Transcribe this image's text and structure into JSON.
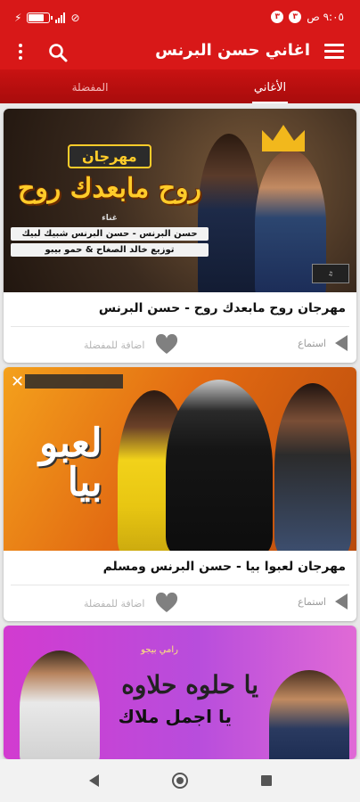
{
  "status_bar": {
    "time": "٩:٠٥ ص",
    "notification_icons": [
      "٣",
      "٣"
    ],
    "battery_level": 0.76,
    "battery_label": "76"
  },
  "app_bar": {
    "title": "اغاني حسن البرنس",
    "icons": [
      "menu-icon",
      "search-icon",
      "more-vert-icon"
    ]
  },
  "tabs": [
    {
      "label": "الأغاني",
      "active": true
    },
    {
      "label": "المفضلة",
      "active": false
    }
  ],
  "cards": [
    {
      "title": "مهرجان روح مابعدك روح - حسن البرنس",
      "play_label": "استماع",
      "fav_label": "اضافة للمفضلة",
      "thumbnail": {
        "badge": "مهرجان",
        "title": "روح مابعدك روح",
        "lines": [
          "غناء",
          "حسن البرنس - حسن البرنس شبيك لبيك",
          "توزيع خالد الصغاح & حمو بيبو"
        ]
      }
    },
    {
      "title": "مهرجان لعبوا بيا - حسن البرنس ومسلم",
      "play_label": "استماع",
      "fav_label": "اضافة للمفضلة",
      "thumbnail": {
        "title_line1": "لعبو",
        "title_line2": "بيا"
      }
    },
    {
      "title": "",
      "thumbnail": {
        "small": "رامي بيجو",
        "title": "يا حلوه حلاوه",
        "subtitle": "يا اجمل ملاك"
      }
    }
  ],
  "colors": {
    "primary": "#d81818",
    "tab_bg": "#b80e0e"
  }
}
